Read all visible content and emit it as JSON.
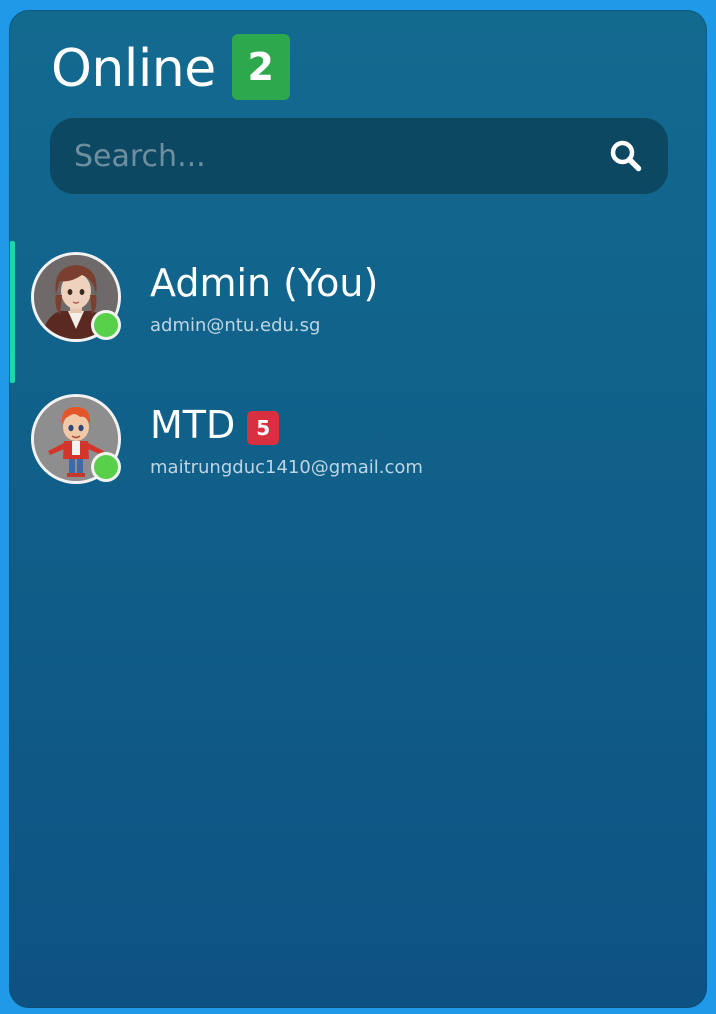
{
  "header": {
    "title": "Online",
    "count": "2",
    "count_badge_color": "#2ea84c"
  },
  "search": {
    "placeholder": "Search...",
    "value": "",
    "icon": "search-icon"
  },
  "users": [
    {
      "name": "Admin (You)",
      "email": "admin@ntu.edu.sg",
      "status": "online",
      "active": true,
      "unread": null,
      "avatar": "girl-avatar"
    },
    {
      "name": "MTD",
      "email": "maitrungduc1410@gmail.com",
      "status": "online",
      "active": false,
      "unread": "5",
      "avatar": "boy-avatar"
    }
  ],
  "colors": {
    "background": "#1e9ae8",
    "panel": "#10608a",
    "active_indicator": "#20d6a8",
    "online": "#59d04a",
    "unread_badge": "#d8303f"
  }
}
